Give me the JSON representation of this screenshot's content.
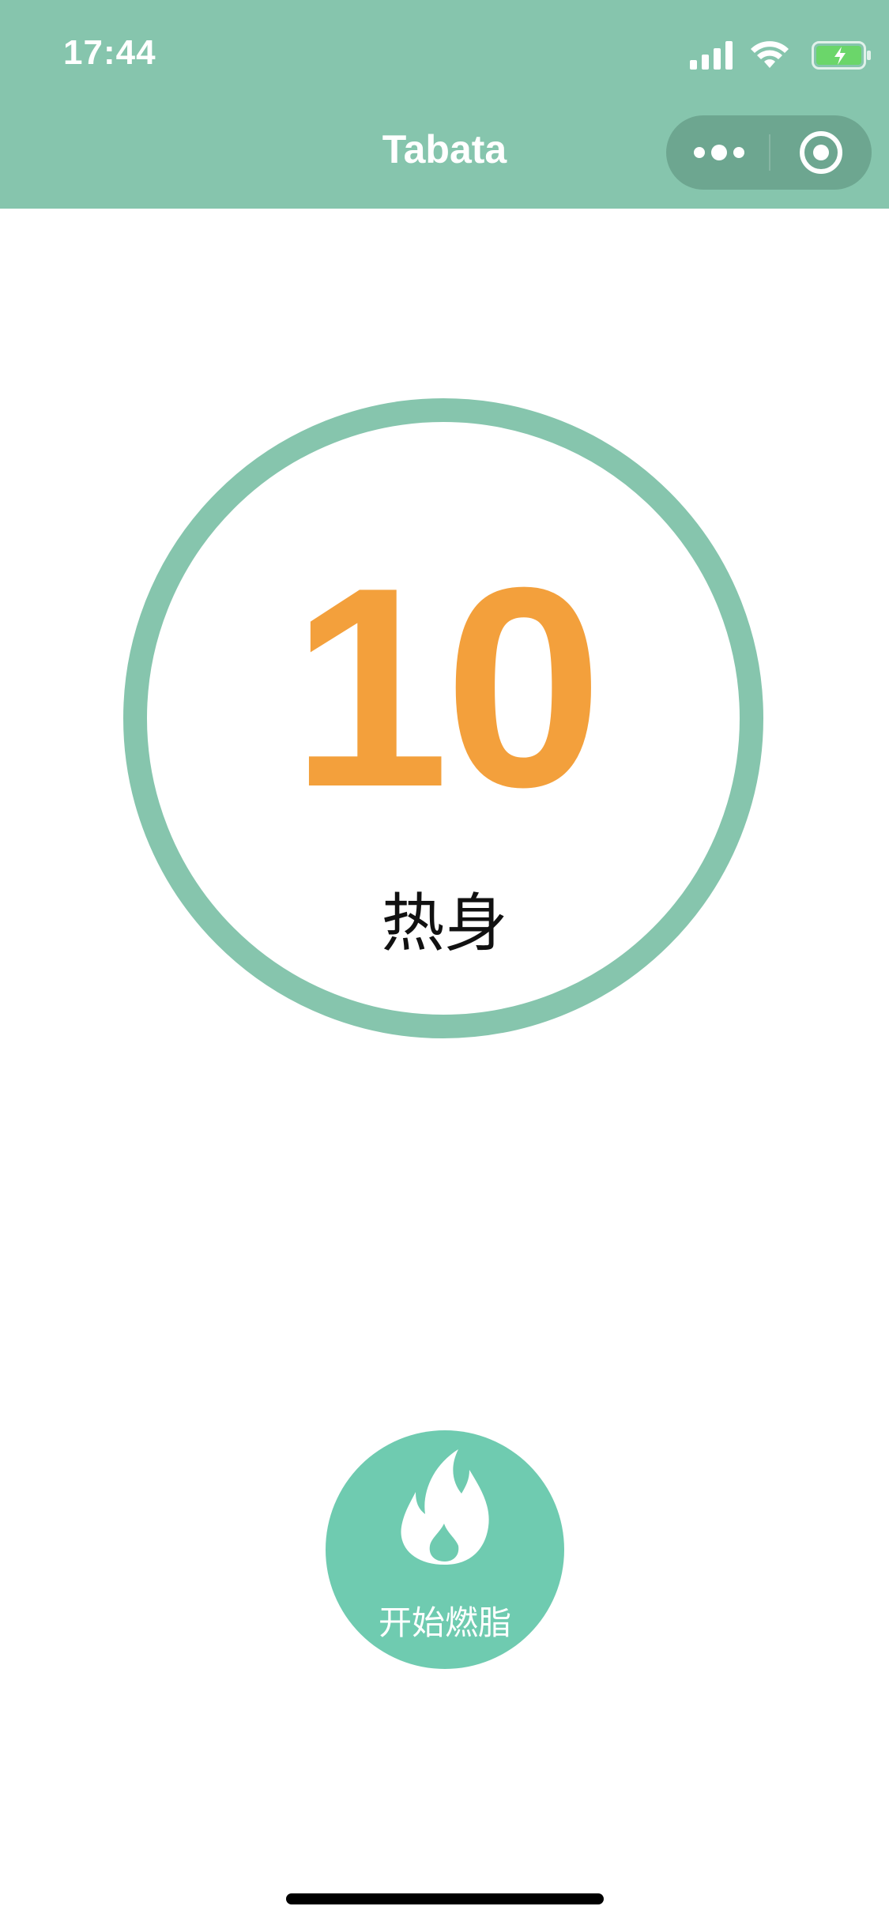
{
  "status_bar": {
    "time": "17:44",
    "icons": [
      "signal-icon",
      "wifi-icon",
      "battery-charging-icon"
    ]
  },
  "nav": {
    "title": "Tabata",
    "capsule_icons": [
      "more-icon",
      "close-circle-icon"
    ]
  },
  "timer": {
    "value": "10",
    "phase": "热身"
  },
  "start_button": {
    "label": "开始燃脂",
    "icon": "flame-icon"
  },
  "colors": {
    "header": "#86c5ad",
    "ring": "#86c5ad",
    "timer_text": "#f3a03c",
    "button": "#6fcbb0"
  }
}
